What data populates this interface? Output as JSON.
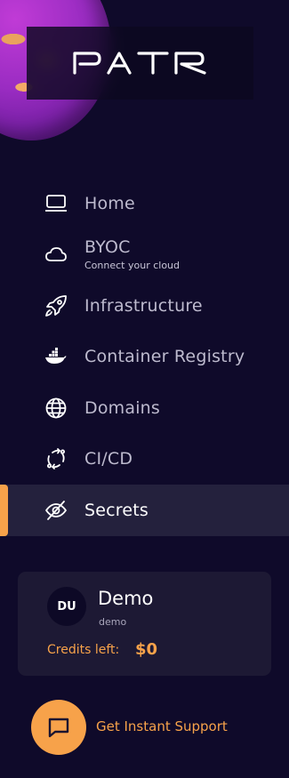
{
  "brand": {
    "logo_text": "PATR"
  },
  "nav": {
    "items": [
      {
        "label": "Home",
        "icon": "laptop-icon"
      },
      {
        "label": "BYOC",
        "sublabel": "Connect your cloud",
        "icon": "cloud-icon"
      },
      {
        "label": "Infrastructure",
        "icon": "rocket-icon"
      },
      {
        "label": "Container Registry",
        "icon": "docker-icon"
      },
      {
        "label": "Domains",
        "icon": "globe-icon"
      },
      {
        "label": "CI/CD",
        "icon": "cicd-icon"
      },
      {
        "label": "Secrets",
        "icon": "eye-off-icon",
        "active": true
      }
    ]
  },
  "user": {
    "initials": "DU",
    "name": "Demo",
    "handle": "demo",
    "credits_label": "Credits left:",
    "credits_value": "$0"
  },
  "support": {
    "label": "Get Instant Support",
    "icon": "chat-icon"
  },
  "colors": {
    "background": "#0f0a2a",
    "accent": "#f7a24a",
    "active_bg": "#24213d",
    "card_bg": "#1d1934"
  }
}
